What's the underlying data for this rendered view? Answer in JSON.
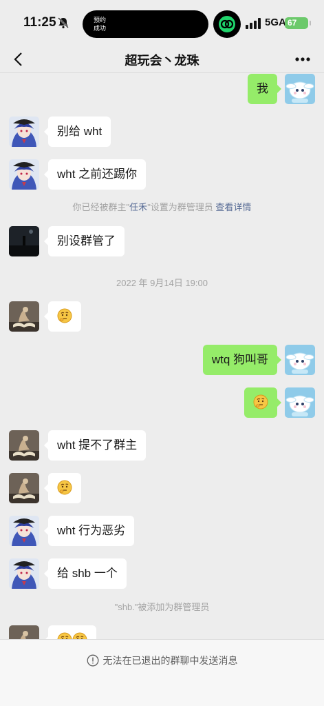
{
  "status_bar": {
    "time": "11:25",
    "island_line1": "预约",
    "island_line2": "成功",
    "network": "5GA",
    "battery": "67"
  },
  "header": {
    "title": "超玩会丶龙珠"
  },
  "messages": [
    {
      "side": "out",
      "text": "我"
    },
    {
      "side": "in",
      "text": "别给 wht"
    },
    {
      "side": "in",
      "text": "wht 之前还踢你"
    },
    {
      "type": "system",
      "prefix": "你已经被群主\"",
      "name": "任禾",
      "suffix": "\"设置为群管理员 ",
      "link": "查看详情"
    },
    {
      "side": "in",
      "text": "别设群管了"
    },
    {
      "type": "time",
      "text": "2022 年 9月14日 19:00"
    },
    {
      "side": "in",
      "emoji": "thinking-face"
    },
    {
      "side": "out",
      "text": "wtq 狗叫哥"
    },
    {
      "side": "out",
      "emoji": "thinking-face"
    },
    {
      "side": "in",
      "text": "wht 提不了群主"
    },
    {
      "side": "in",
      "emoji": "thinking-face"
    },
    {
      "side": "in",
      "text": "wht 行为恶劣"
    },
    {
      "side": "in",
      "text": "给 shb 一个"
    },
    {
      "type": "system",
      "text": "\"shb.\"被添加为群管理员"
    },
    {
      "side": "in",
      "emoji": "thinking-face x2"
    }
  ],
  "footer": {
    "notice": "无法在已退出的群聊中发送消息"
  },
  "colors": {
    "background": "#ededed",
    "outgoing_bubble": "#95ec69",
    "incoming_bubble": "#ffffff",
    "link": "#576b95",
    "battery": "#6cc96b"
  }
}
